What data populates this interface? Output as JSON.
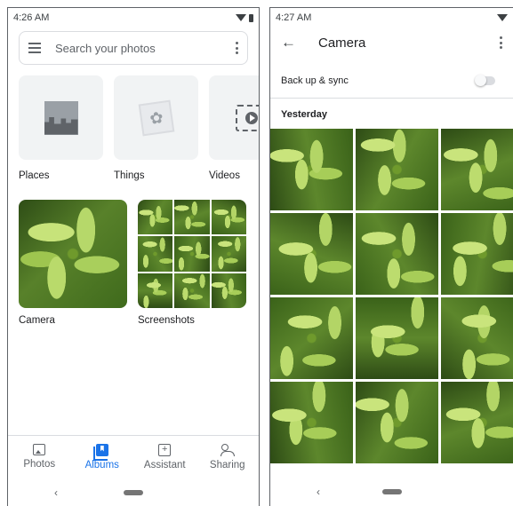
{
  "left": {
    "status": {
      "time": "4:26 AM"
    },
    "search": {
      "placeholder": "Search your photos"
    },
    "categories": [
      {
        "label": "Places",
        "icon": "places-icon"
      },
      {
        "label": "Things",
        "icon": "things-icon"
      },
      {
        "label": "Videos",
        "icon": "videos-icon"
      }
    ],
    "albums": [
      {
        "label": "Camera"
      },
      {
        "label": "Screenshots"
      }
    ],
    "nav": [
      {
        "label": "Photos",
        "icon": "photos-icon",
        "active": false
      },
      {
        "label": "Albums",
        "icon": "albums-icon",
        "active": true
      },
      {
        "label": "Assistant",
        "icon": "assistant-icon",
        "active": false
      },
      {
        "label": "Sharing",
        "icon": "sharing-icon",
        "active": false
      }
    ]
  },
  "right": {
    "status": {
      "time": "4:27 AM"
    },
    "title": "Camera",
    "backup": {
      "label": "Back up & sync",
      "enabled": false
    },
    "section": "Yesterday",
    "photo_count": 12
  },
  "colors": {
    "accent": "#1a73e8",
    "text": "#202124",
    "secondary": "#5f6368",
    "tile": "#f1f3f4"
  }
}
